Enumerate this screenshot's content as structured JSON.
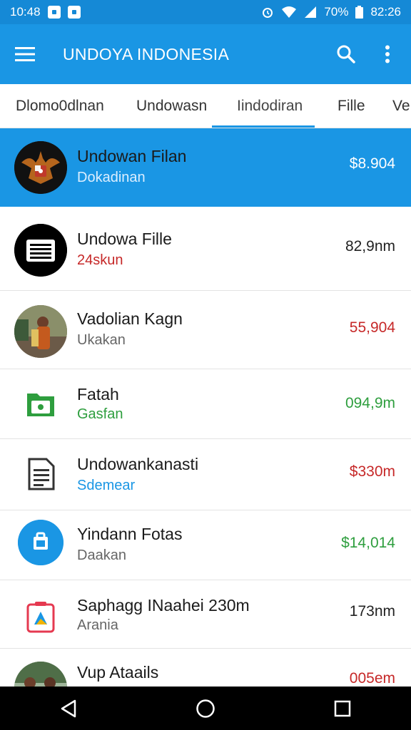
{
  "status": {
    "time": "10:48",
    "battery": "70%",
    "clock_right": "82:26"
  },
  "appbar": {
    "title": "UNDOYA INDONESIA"
  },
  "tabs": [
    {
      "label": "Dlomo0dlnan"
    },
    {
      "label": "Undowasn"
    },
    {
      "label": "Iindodiran"
    },
    {
      "label": "Fille"
    },
    {
      "label": "Ve"
    }
  ],
  "items": [
    {
      "name": "Undowan Filan",
      "sub": "Dokadinan",
      "value": "$8.904",
      "sub_color": "#dbeeff",
      "value_color": "#ffffff",
      "icon": "garuda-emblem-icon"
    },
    {
      "name": "Undowa Fille",
      "sub": "24skun",
      "value": "82,9nm",
      "sub_color": "#c62828",
      "value_color": "#222222",
      "icon": "document-list-icon"
    },
    {
      "name": "Vadolian Kagn",
      "sub": "Ukakan",
      "value": "55,904",
      "sub_color": "#666666",
      "value_color": "#c62828",
      "icon": "person-photo-icon"
    },
    {
      "name": "Fatah",
      "sub": "Gasfan",
      "value": "094,9m",
      "sub_color": "#2e9e3e",
      "value_color": "#2e9e3e",
      "icon": "green-folder-icon"
    },
    {
      "name": "Undowankanasti",
      "sub": "Sdemear",
      "value": "$330m",
      "sub_color": "#1a96e4",
      "value_color": "#c62828",
      "icon": "document-icon"
    },
    {
      "name": "Yindann Fotas",
      "sub": "Daakan",
      "value": "$14,014",
      "sub_color": "#666666",
      "value_color": "#2e9e3e",
      "icon": "bag-icon"
    },
    {
      "name": "Saphagg INaahei 230m",
      "sub": "Arania",
      "value": "173nm",
      "sub_color": "#666666",
      "value_color": "#222222",
      "icon": "slides-icon"
    },
    {
      "name": "Vup Ataails",
      "sub": "",
      "value": "005em",
      "sub_color": "#666666",
      "value_color": "#c62828",
      "icon": "group-photo-icon"
    }
  ],
  "colors": {
    "primary": "#1a96e4",
    "status": "#1589d6",
    "red": "#c62828",
    "green": "#2e9e3e"
  }
}
